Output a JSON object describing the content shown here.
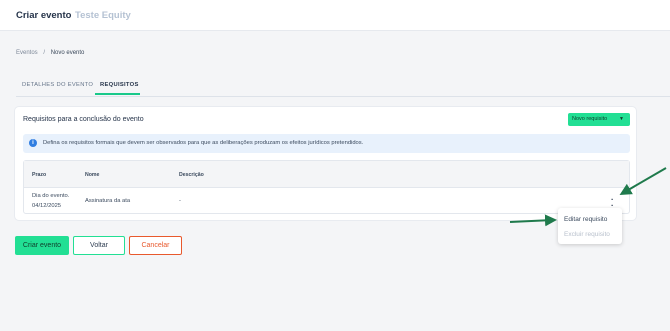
{
  "header": {
    "title": "Criar evento",
    "subtitle": "Teste Equity"
  },
  "breadcrumb": {
    "root": "Eventos",
    "separator": "/",
    "current": "Novo evento"
  },
  "tabs": [
    {
      "label": "DETALHES DO EVENTO",
      "active": false
    },
    {
      "label": "REQUISITOS",
      "active": true
    }
  ],
  "requirements": {
    "title": "Requisitos para a conclusão do evento",
    "new_button": "Novo requisito",
    "info_text": "Defina os requisitos formais que devem ser observados para que as deliberações produzam os efeitos jurídicos pretendidos.",
    "columns": {
      "prazo": "Prazo",
      "nome": "Nome",
      "descricao": "Descrição"
    },
    "rows": [
      {
        "prazo_label": "Dia do evento.",
        "prazo_date": "04/12/2025",
        "nome": "Assinatura da ata",
        "descricao": "-"
      }
    ]
  },
  "row_menu": {
    "edit": "Editar requisito",
    "delete": "Excluir requisito"
  },
  "actions": {
    "create": "Criar evento",
    "back": "Voltar",
    "cancel": "Cancelar"
  },
  "colors": {
    "accent": "#22df94",
    "danger": "#e8592d",
    "info_bg": "#e8f1fc",
    "annotation_arrow": "#1f7a4c"
  }
}
